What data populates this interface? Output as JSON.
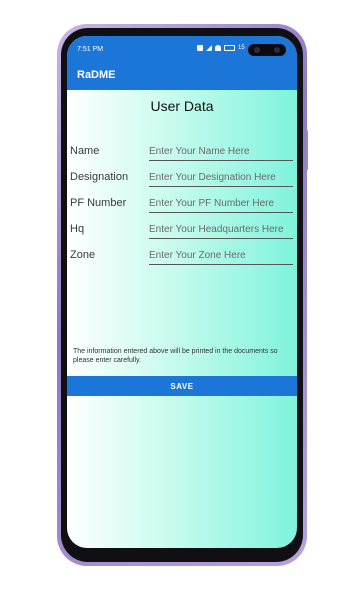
{
  "status_bar": {
    "time": "7:51 PM",
    "battery_pct": "15"
  },
  "app_bar": {
    "title": "RaDME"
  },
  "page": {
    "title": "User Data"
  },
  "form": {
    "fields": [
      {
        "label": "Name",
        "placeholder": "Enter Your Name Here"
      },
      {
        "label": "Designation",
        "placeholder": "Enter Your Designation Here"
      },
      {
        "label": "PF Number",
        "placeholder": "Enter Your PF Number Here"
      },
      {
        "label": "Hq",
        "placeholder": "Enter Your Headquarters Here"
      },
      {
        "label": "Zone",
        "placeholder": "Enter Your Zone Here"
      }
    ]
  },
  "notice": "The information entered above will be printed in the documents so please enter carefully.",
  "save_label": "SAVE",
  "colors": {
    "accent": "#1c76d8",
    "frame": "#9b86cc"
  }
}
